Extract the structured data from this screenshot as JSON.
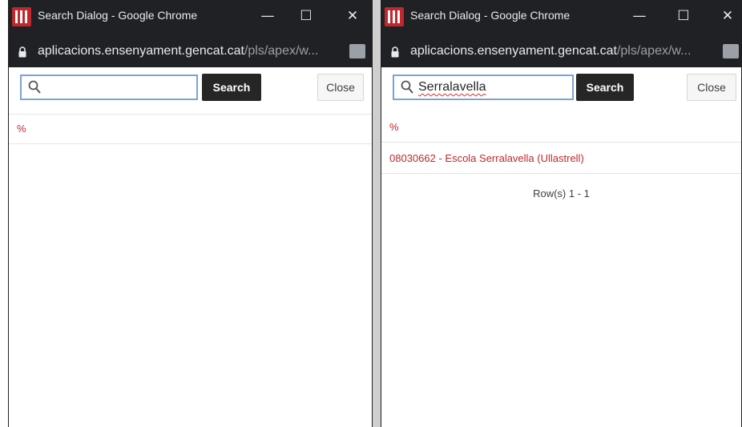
{
  "windows": [
    {
      "title": "Search Dialog - Google Chrome",
      "url_host": "aplicacions.ensenyament.gencat.cat",
      "url_path": "/pls/apex/w...",
      "search_value": "",
      "search_button_label": "Search",
      "close_button_label": "Close",
      "results": [
        "%"
      ],
      "pager": ""
    },
    {
      "title": "Search Dialog - Google Chrome",
      "url_host": "aplicacions.ensenyament.gencat.cat",
      "url_path": "/pls/apex/w...",
      "search_value": "Serralavella",
      "search_button_label": "Search",
      "close_button_label": "Close",
      "results": [
        "%",
        "08030662 - Escola Serralavella (Ullastrell)"
      ],
      "pager": "Row(s) 1 - 1"
    }
  ],
  "window_controls": {
    "minimize": "—",
    "maximize": "☐",
    "close": "✕"
  },
  "colors": {
    "titlebar": "#202124",
    "accent_red": "#c1272d",
    "search_button": "#262626"
  }
}
